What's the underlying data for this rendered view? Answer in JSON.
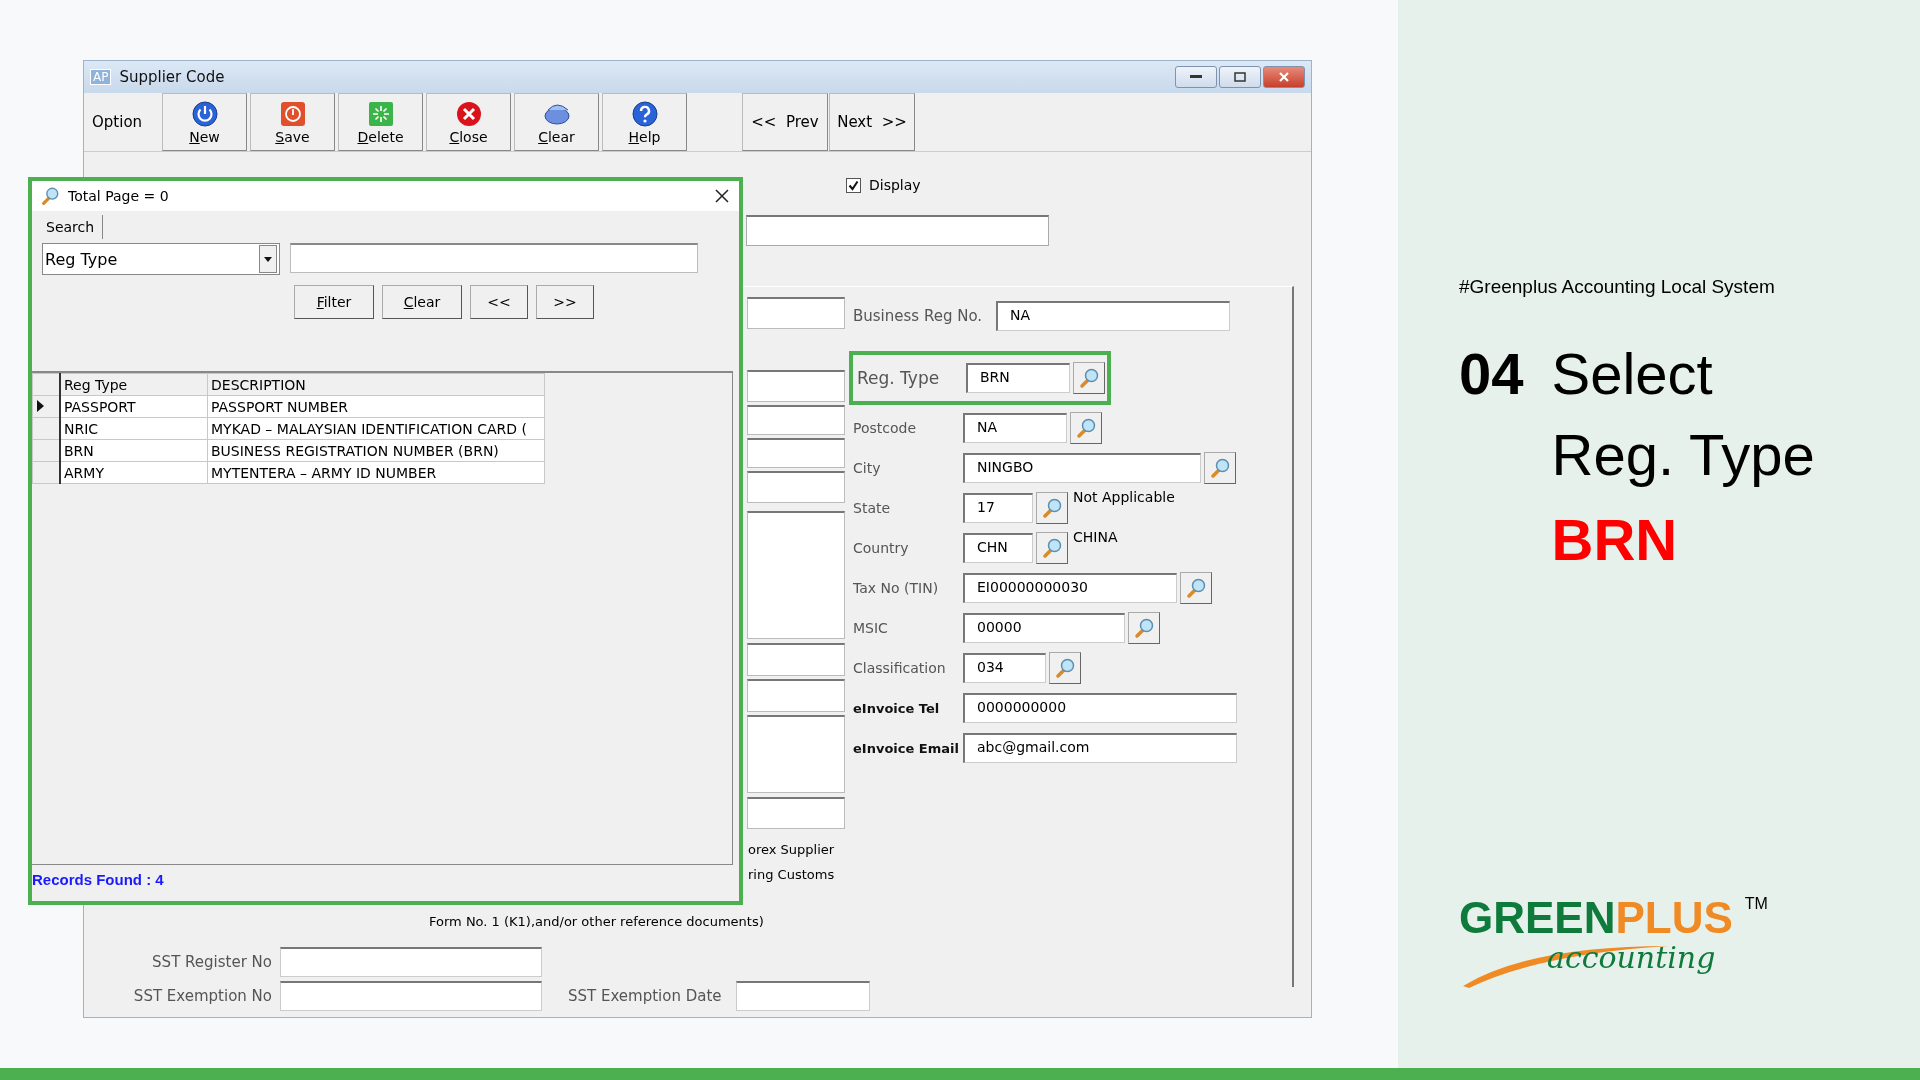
{
  "window": {
    "app_badge": "AP",
    "title": "Supplier Code"
  },
  "toolbar": {
    "label": "Option",
    "buttons": [
      {
        "label": "New",
        "kind": "power"
      },
      {
        "label": "Save",
        "kind": "save"
      },
      {
        "label": "Delete",
        "kind": "delete"
      },
      {
        "label": "Close",
        "kind": "close"
      },
      {
        "label": "Clear",
        "kind": "clear"
      },
      {
        "label": "Help",
        "kind": "help"
      }
    ],
    "nav": [
      "<<  Prev",
      "Next  >>"
    ]
  },
  "form": {
    "display": {
      "label": "Display",
      "checked": true
    },
    "fields": [
      {
        "label": "Business Reg No.",
        "value": "NA",
        "lookup": false,
        "highlighted": false
      },
      {
        "label": "Reg. Type",
        "value": "BRN",
        "lookup": true,
        "highlighted": true
      },
      {
        "label": "Postcode",
        "value": "NA",
        "lookup": true,
        "highlighted": false
      },
      {
        "label": "City",
        "value": "NINGBO",
        "lookup": true,
        "highlighted": false
      },
      {
        "label": "State",
        "value": "17",
        "lookup": true,
        "highlighted": false,
        "note": "Not Applicable"
      },
      {
        "label": "Country",
        "value": "CHN",
        "lookup": true,
        "highlighted": false,
        "note": "CHINA"
      },
      {
        "label": "Tax No (TIN)",
        "value": "EI00000000030",
        "lookup": true,
        "highlighted": false
      },
      {
        "label": "MSIC",
        "value": "00000",
        "lookup": true,
        "highlighted": false
      },
      {
        "label": "Classification",
        "value": "034",
        "lookup": true,
        "highlighted": false
      },
      {
        "label": "eInvoice Tel",
        "value": "0000000000",
        "lookup": false,
        "highlighted": false
      },
      {
        "label": "eInvoice Email",
        "value": "abc@gmail.com",
        "lookup": false,
        "highlighted": false
      }
    ],
    "partial_texts": [
      "orex Supplier",
      "ring Customs"
    ],
    "form_note": "Form No. 1 (K1),and/or other reference documents)",
    "sst": [
      {
        "label": "SST Register No"
      },
      {
        "label": "SST Exemption No"
      },
      {
        "label": "SST Exemption Date"
      }
    ]
  },
  "dialog": {
    "title": "Total Page = 0",
    "highlighted": true,
    "tab": "Search",
    "filter_by": "Reg Type",
    "buttons": [
      "Filter",
      "Clear",
      "<<",
      ">>"
    ],
    "table": {
      "columns": [
        "Reg Type",
        "DESCRIPTION"
      ],
      "rows": [
        {
          "cells": [
            "PASSPORT",
            "PASSPORT NUMBER"
          ],
          "selected": true
        },
        {
          "cells": [
            "NRIC",
            "MYKAD – MALAYSIAN IDENTIFICATION CARD ("
          ],
          "selected": false
        },
        {
          "cells": [
            "BRN",
            "BUSINESS REGISTRATION NUMBER (BRN)"
          ],
          "selected": false
        },
        {
          "cells": [
            "ARMY",
            "MYTENTERA – ARMY ID NUMBER"
          ],
          "selected": false
        }
      ]
    },
    "status": "Records Found : 4"
  },
  "slide": {
    "hashtag": "#Greenplus Accounting Local System",
    "step_number": "04",
    "step_lines": [
      "Select",
      "Reg. Type"
    ],
    "highlight": "BRN",
    "logo": {
      "green_part": "GREEN",
      "orange_part": "PLUS",
      "trademark": "TM",
      "tagline": "accounting"
    }
  }
}
